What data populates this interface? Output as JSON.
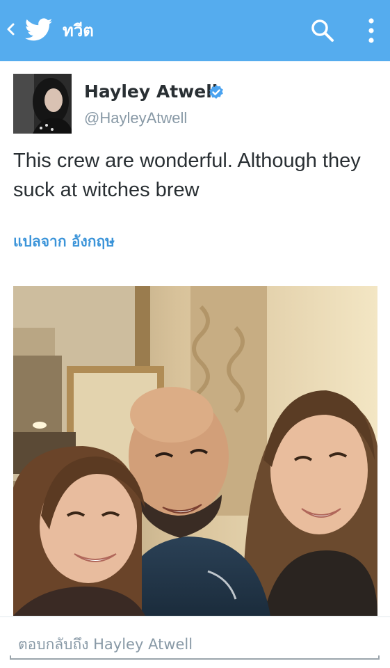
{
  "colors": {
    "topbar": "#55acee",
    "link": "#3b94d9",
    "verified": "#4aa3f0",
    "text": "#292f33",
    "muted": "#8899a6"
  },
  "topbar": {
    "title": "ทวีต",
    "back_icon": "chevron-left-icon",
    "logo_icon": "twitter-bird-icon",
    "search_icon": "search-icon",
    "more_icon": "more-vertical-icon"
  },
  "tweet": {
    "author_name": "Hayley Atwell",
    "handle": "@HayleyAtwell",
    "verified_icon": "verified-badge-icon",
    "text": "This crew are wonderful. Although they suck at witches brew",
    "translate_label": "แปลจาก อังกฤษ"
  },
  "reply": {
    "placeholder": "ตอบกลับถึง Hayley Atwell"
  }
}
